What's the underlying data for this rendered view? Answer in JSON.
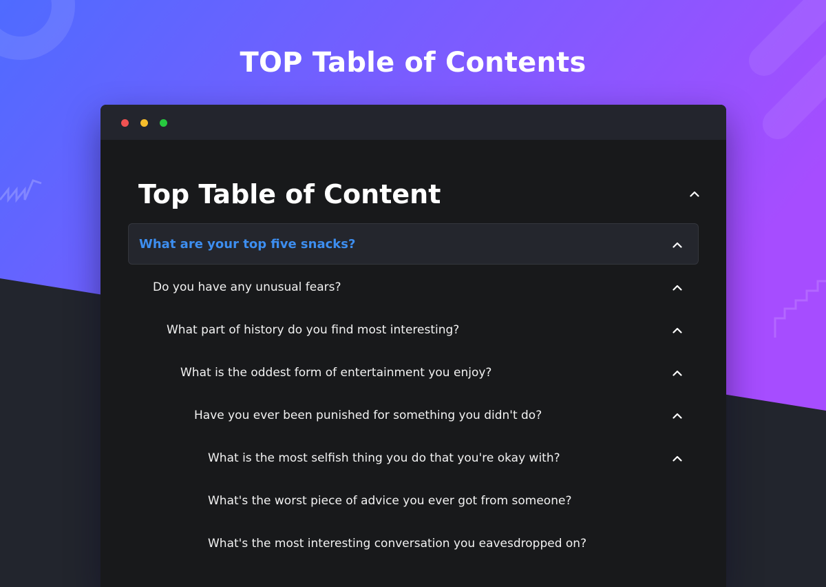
{
  "page": {
    "title": "TOP Table of Contents"
  },
  "colors": {
    "gradient_start": "#4f6bff",
    "gradient_end": "#a64dff",
    "window_bg": "#18191b",
    "titlebar_bg": "#23252d",
    "active_text": "#3d8ef0"
  },
  "window": {
    "buttons": [
      "close",
      "minimize",
      "maximize"
    ]
  },
  "toc": {
    "title": "Top Table of Content",
    "toggle_icon": "chevron-up-icon",
    "items": [
      {
        "label": "What are your top five snacks?",
        "level": 0,
        "active": true,
        "has_toggle": true
      },
      {
        "label": "Do you have any unusual fears?",
        "level": 1,
        "active": false,
        "has_toggle": true
      },
      {
        "label": "What part of history do you find most interesting?",
        "level": 2,
        "active": false,
        "has_toggle": true
      },
      {
        "label": "What is the oddest form of entertainment you enjoy?",
        "level": 3,
        "active": false,
        "has_toggle": true
      },
      {
        "label": "Have you ever been punished for something you didn't do?",
        "level": 4,
        "active": false,
        "has_toggle": true
      },
      {
        "label": "What is the most selfish thing you do that you're okay with?",
        "level": 5,
        "active": false,
        "has_toggle": true
      },
      {
        "label": "What's the worst piece of advice you ever got from someone?",
        "level": 5,
        "active": false,
        "has_toggle": false
      },
      {
        "label": "What's the most interesting conversation you eavesdropped on?",
        "level": 5,
        "active": false,
        "has_toggle": false
      }
    ]
  }
}
